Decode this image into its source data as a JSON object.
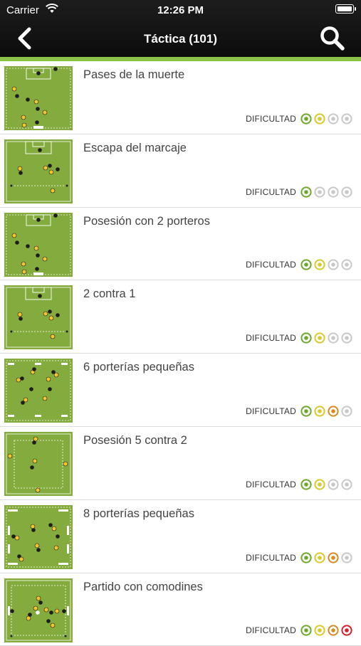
{
  "status_bar": {
    "carrier": "Carrier",
    "time": "12:26 PM"
  },
  "header": {
    "title": "Táctica (101)",
    "back_icon": "chevron-left-icon",
    "search_icon": "search-icon"
  },
  "colors": {
    "accent": "#8bc34a",
    "field": "#84ab3d",
    "level_inactive": "#c8c8c8",
    "level_1": "#6aa92a",
    "level_2": "#d9c92a",
    "level_3": "#d78a1f",
    "level_4": "#d3202a"
  },
  "difficulty_label": "DIFICULTAD",
  "drills": [
    {
      "name": "Pases de la muerte",
      "difficulty": 2,
      "thumb": "goal-top-bottom"
    },
    {
      "name": "Escapa del marcaje",
      "difficulty": 1,
      "thumb": "goal-top"
    },
    {
      "name": "Posesión con 2 porteros",
      "difficulty": 2,
      "thumb": "goal-top-bottom"
    },
    {
      "name": "2 contra 1",
      "difficulty": 2,
      "thumb": "goal-top"
    },
    {
      "name": "6 porterías pequeñas",
      "difficulty": 3,
      "thumb": "small-goals"
    },
    {
      "name": "Posesión 5 contra 2",
      "difficulty": 2,
      "thumb": "square"
    },
    {
      "name": "8 porterías pequeñas",
      "difficulty": 3,
      "thumb": "small-goals-side"
    },
    {
      "name": "Partido con comodines",
      "difficulty": 4,
      "thumb": "side-goals"
    }
  ]
}
